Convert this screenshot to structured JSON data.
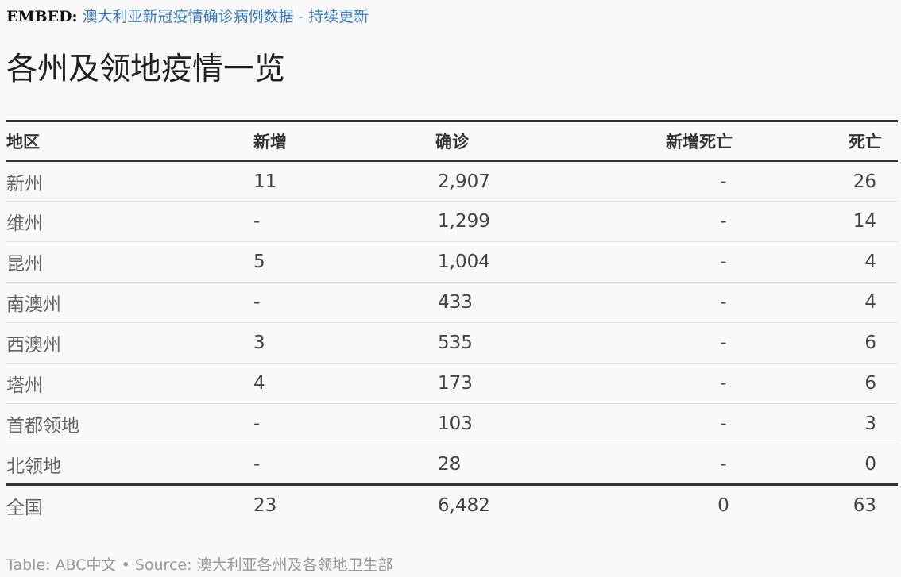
{
  "embed": {
    "label": "EMBED:",
    "link_text": "澳大利亚新冠疫情确诊病例数据 - 持续更新"
  },
  "page_title": "各州及领地疫情一览",
  "table": {
    "columns": [
      "地区",
      "新增",
      "确诊",
      "新增死亡",
      "死亡"
    ],
    "rows": [
      {
        "region": "新州",
        "new": "11",
        "confirmed": "2,907",
        "new_deaths": "-",
        "deaths": "26"
      },
      {
        "region": "维州",
        "new": "-",
        "confirmed": "1,299",
        "new_deaths": "-",
        "deaths": "14"
      },
      {
        "region": "昆州",
        "new": "5",
        "confirmed": "1,004",
        "new_deaths": "-",
        "deaths": "4"
      },
      {
        "region": "南澳州",
        "new": "-",
        "confirmed": "433",
        "new_deaths": "-",
        "deaths": "4"
      },
      {
        "region": "西澳州",
        "new": "3",
        "confirmed": "535",
        "new_deaths": "-",
        "deaths": "6"
      },
      {
        "region": "塔州",
        "new": "4",
        "confirmed": "173",
        "new_deaths": "-",
        "deaths": "6"
      },
      {
        "region": "首都领地",
        "new": "-",
        "confirmed": "103",
        "new_deaths": "-",
        "deaths": "3"
      },
      {
        "region": "北领地",
        "new": "-",
        "confirmed": "28",
        "new_deaths": "-",
        "deaths": "0"
      }
    ],
    "total": {
      "region": "全国",
      "new": "23",
      "confirmed": "6,482",
      "new_deaths": "0",
      "deaths": "63"
    }
  },
  "footer": {
    "text": "Table: ABC中文 • Source: 澳大利亚各州及各领地卫生部"
  },
  "colors": {
    "link": "#3b79c4",
    "rule": "#333333",
    "row_divider": "#e3e3e3",
    "footer_text": "#999999"
  }
}
